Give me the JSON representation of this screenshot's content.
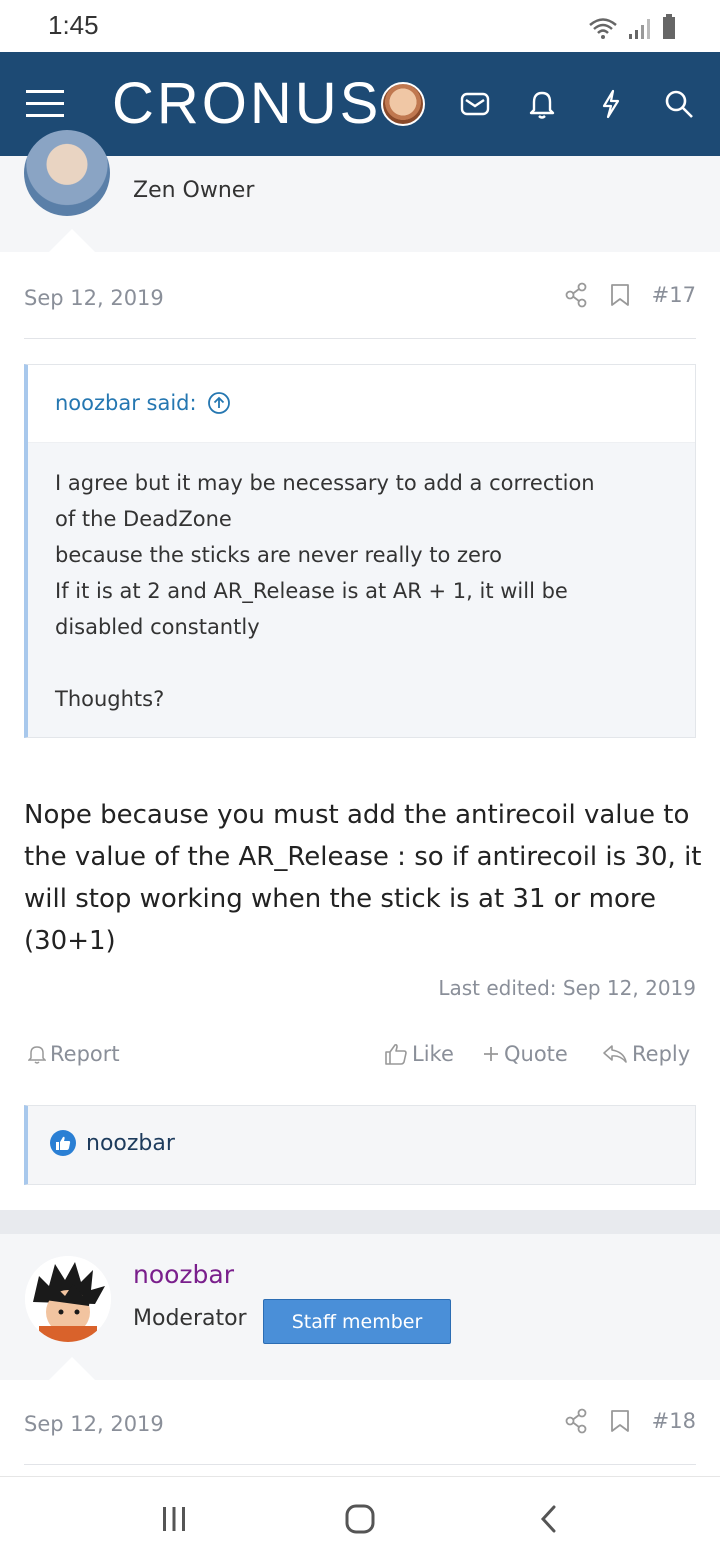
{
  "status_bar": {
    "time": "1:45"
  },
  "navbar": {
    "logo_text": "CRONUS"
  },
  "post1": {
    "user_title": "Zen Owner",
    "date": "Sep 12, 2019",
    "number": "#17",
    "quote": {
      "author": "noozbar said:",
      "lines": [
        "I agree but it may be necessary to add a correction",
        "of the DeadZone",
        "because the sticks are never really to zero",
        "If it is at 2 and AR_Release is at AR + 1, it will be",
        "disabled constantly",
        "",
        "Thoughts?"
      ]
    },
    "body_lines": [
      "Nope because you must add the antirecoil value to",
      "the value of the AR_Release : so if antirecoil is 30, it",
      "will stop working when the stick is at 31 or more",
      "(30+1)"
    ],
    "last_edited": "Last edited: Sep 12, 2019",
    "actions": {
      "report": "Report",
      "like": "Like",
      "quote": "Quote",
      "reply": "Reply"
    },
    "reactions": {
      "user": "noozbar"
    }
  },
  "post2": {
    "username": "noozbar",
    "user_title": "Moderator",
    "badge": "Staff member",
    "date": "Sep 12, 2019",
    "number": "#18"
  },
  "colors": {
    "navbar": "#1d4a74",
    "link": "#2577b1",
    "staff_badge": "#4a8fd8",
    "moderator_name": "#7a1f8c"
  }
}
